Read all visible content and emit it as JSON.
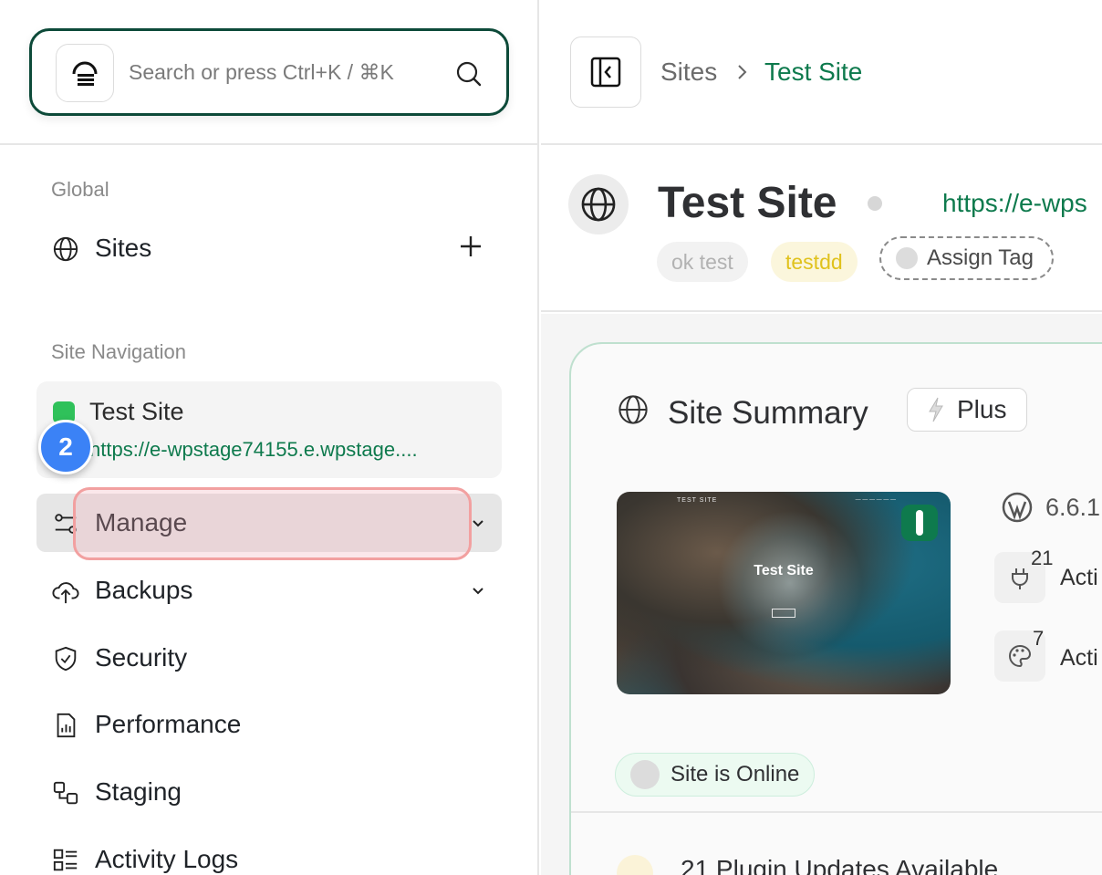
{
  "search": {
    "placeholder": "Search or press Ctrl+K / ⌘K"
  },
  "sidebar": {
    "global_label": "Global",
    "sites_label": "Sites",
    "site_nav_label": "Site Navigation",
    "current_site": {
      "name": "Test Site",
      "url": "https://e-wpstage74155.e.wpstage...."
    },
    "step_badge": "2",
    "items": [
      {
        "label": "Manage",
        "icon": "sliders-icon",
        "expandable": true
      },
      {
        "label": "Backups",
        "icon": "cloud-upload-icon",
        "expandable": true
      },
      {
        "label": "Security",
        "icon": "shield-check-icon",
        "expandable": false
      },
      {
        "label": "Performance",
        "icon": "report-chart-icon",
        "expandable": false
      },
      {
        "label": "Staging",
        "icon": "staging-icon",
        "expandable": false
      },
      {
        "label": "Activity Logs",
        "icon": "list-grid-icon",
        "expandable": false
      }
    ]
  },
  "breadcrumb": {
    "parent": "Sites",
    "current": "Test Site"
  },
  "site_header": {
    "title": "Test Site",
    "url": "https://e-wps",
    "tags": [
      "ok test",
      "testdd"
    ],
    "assign_tag_label": "Assign Tag"
  },
  "summary": {
    "title": "Site Summary",
    "plan_badge": "Plus",
    "thumbnail_title": "Test Site",
    "thumbnail_header": "TEST SITE",
    "wp_version": "6.6.1",
    "plugins": {
      "count": "21",
      "label": "Acti"
    },
    "themes": {
      "count": "7",
      "label": "Acti"
    },
    "status": "Site is Online",
    "updates": "21 Plugin Updates Available"
  },
  "colors": {
    "brand_green": "#0e7a4d",
    "accent_blue": "#3b82f6",
    "online_bg": "#ecfaf1"
  }
}
